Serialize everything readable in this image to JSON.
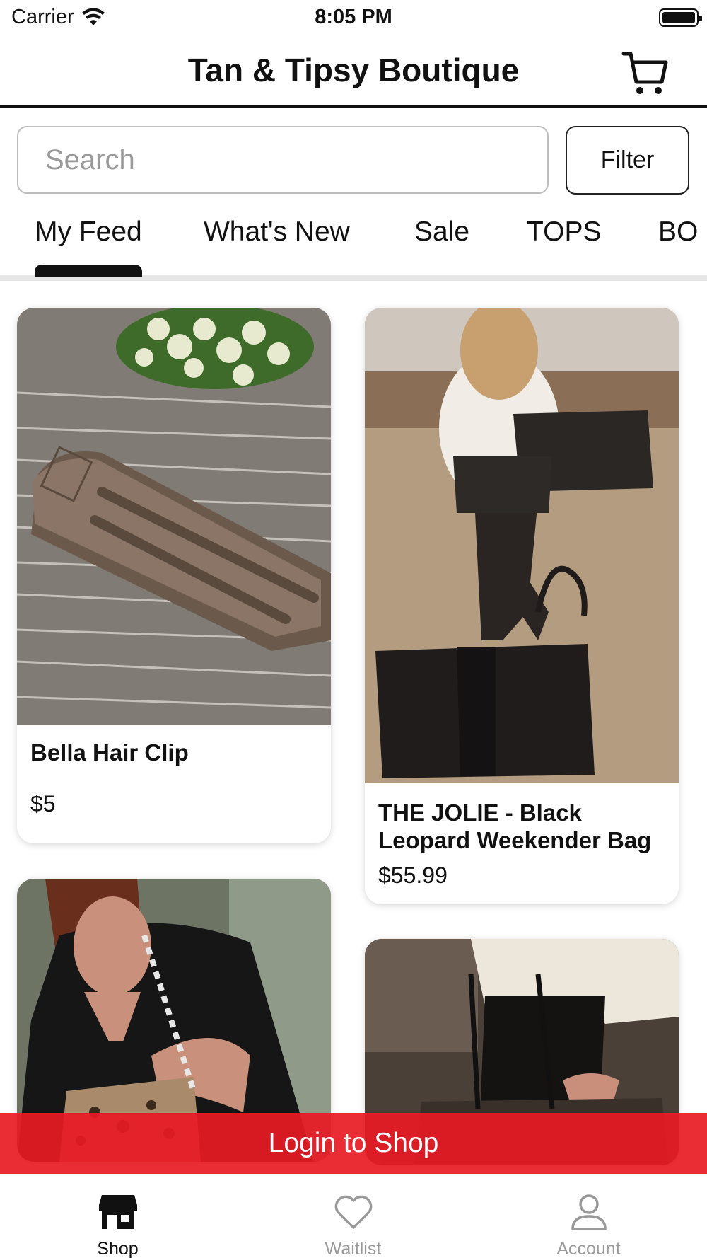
{
  "status_bar": {
    "carrier": "Carrier",
    "time": "8:05 PM"
  },
  "header": {
    "title": "Tan & Tipsy Boutique",
    "cart_icon": "cart-icon"
  },
  "search": {
    "placeholder": "Search",
    "value": ""
  },
  "filter": {
    "label": "Filter"
  },
  "tabs": [
    {
      "label": "My Feed",
      "active": true
    },
    {
      "label": "What's New"
    },
    {
      "label": "Sale"
    },
    {
      "label": "TOPS"
    },
    {
      "label": "BO"
    }
  ],
  "products": [
    {
      "name": "Bella Hair Clip",
      "price": "$5"
    },
    {
      "name": "THE JOLIE - Black Leopard Weekender Bag",
      "price": "$55.99"
    },
    {
      "name": "",
      "price": ""
    },
    {
      "name": "",
      "price": ""
    }
  ],
  "login_banner": {
    "label": "Login to Shop"
  },
  "bottom_nav": [
    {
      "label": "Shop",
      "icon": "storefront-icon",
      "active": true
    },
    {
      "label": "Waitlist",
      "icon": "heart-icon"
    },
    {
      "label": "Account",
      "icon": "person-icon"
    }
  ],
  "colors": {
    "accent": "#e81a24",
    "text": "#111111",
    "inactive": "#999999"
  }
}
